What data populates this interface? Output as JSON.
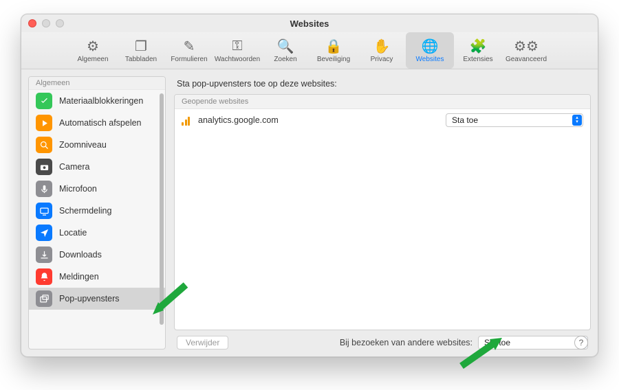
{
  "window": {
    "title": "Websites"
  },
  "traffic": {
    "close": true,
    "minimize_disabled": true,
    "zoom_disabled": true
  },
  "toolbar": {
    "items": [
      {
        "label": "Algemeen",
        "icon": "gear"
      },
      {
        "label": "Tabbladen",
        "icon": "tabs"
      },
      {
        "label": "Formulieren",
        "icon": "form"
      },
      {
        "label": "Wachtwoorden",
        "icon": "key"
      },
      {
        "label": "Zoeken",
        "icon": "magnify"
      },
      {
        "label": "Beveiliging",
        "icon": "lock"
      },
      {
        "label": "Privacy",
        "icon": "hand"
      },
      {
        "label": "Websites",
        "icon": "globe",
        "selected": true
      },
      {
        "label": "Extensies",
        "icon": "puzzle"
      },
      {
        "label": "Geavanceerd",
        "icon": "gears"
      }
    ]
  },
  "sidebar": {
    "header": "Algemeen",
    "items": [
      {
        "label": "Materiaalblokkeringen",
        "color": "#34c759",
        "icon": "check"
      },
      {
        "label": "Automatisch afspelen",
        "color": "#ff9500",
        "icon": "play"
      },
      {
        "label": "Zoomniveau",
        "color": "#ff9500",
        "icon": "zoom"
      },
      {
        "label": "Camera",
        "color": "#4a4a4a",
        "icon": "camera"
      },
      {
        "label": "Microfoon",
        "color": "#8e8e93",
        "icon": "mic"
      },
      {
        "label": "Schermdeling",
        "color": "#0a7aff",
        "icon": "screen"
      },
      {
        "label": "Locatie",
        "color": "#0a7aff",
        "icon": "location"
      },
      {
        "label": "Downloads",
        "color": "#8e8e93",
        "icon": "download"
      },
      {
        "label": "Meldingen",
        "color": "#ff3b30",
        "icon": "bell"
      },
      {
        "label": "Pop-upvensters",
        "color": "#8e8e93",
        "icon": "popup",
        "selected": true
      }
    ]
  },
  "main": {
    "title": "Sta pop-upvensters toe op deze websites:",
    "open_header": "Geopende websites",
    "sites": [
      {
        "domain": "analytics.google.com",
        "favicon": "analytics",
        "value": "Sta toe"
      }
    ],
    "remove_btn": "Verwijder",
    "other_label": "Bij bezoeken van andere websites:",
    "other_value": "Sta toe"
  },
  "help_tooltip": "?"
}
